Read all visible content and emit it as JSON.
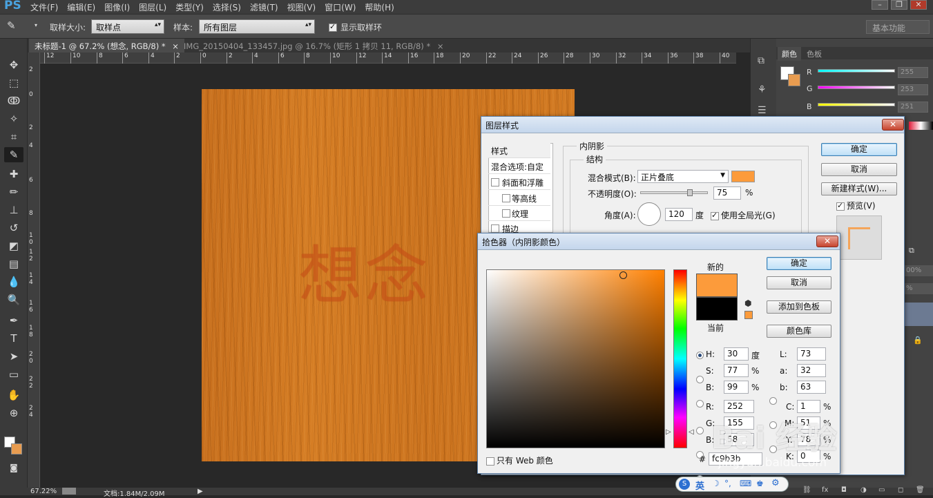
{
  "app": {
    "logo": "PS"
  },
  "menubar": {
    "items": [
      "文件(F)",
      "编辑(E)",
      "图像(I)",
      "图层(L)",
      "类型(Y)",
      "选择(S)",
      "滤镜(T)",
      "视图(V)",
      "窗口(W)",
      "帮助(H)"
    ]
  },
  "options": {
    "sample_size_label": "取样大小:",
    "sample_size_value": "取样点",
    "sample_label": "样本:",
    "sample_value": "所有图层",
    "show_ring_label": "显示取样环",
    "show_ring_checked": true,
    "workspace": "基本功能"
  },
  "tabs": [
    {
      "label": "未标题-1 @ 67.2% (想念, RGB/8) *",
      "active": true
    },
    {
      "label": "IMG_20150404_133457.jpg @ 16.7% (矩形 1 拷贝 11, RGB/8) *",
      "active": false
    }
  ],
  "ruler_h": [
    "12",
    "10",
    "8",
    "6",
    "4",
    "2",
    "0",
    "2",
    "4",
    "6",
    "8",
    "10",
    "12",
    "14",
    "16",
    "18",
    "20",
    "22",
    "24",
    "26",
    "28",
    "30",
    "32",
    "34",
    "36",
    "38",
    "40"
  ],
  "ruler_v": [
    "2",
    "0",
    "2",
    "4",
    "6",
    "8",
    "1 0",
    "1 2",
    "1 4",
    "1 6",
    "1 8",
    "2 0",
    "2 2",
    "2 4"
  ],
  "canvas": {
    "text": "想念"
  },
  "status": {
    "zoom": "67.22%",
    "doc": "文档:1.84M/2.09M"
  },
  "color_panel": {
    "tabs": [
      "颜色",
      "色板"
    ],
    "r_label": "R",
    "g_label": "G",
    "b_label": "B",
    "r": "255",
    "g": "253",
    "b": "251"
  },
  "panel_extras": {
    "pct1": "00%",
    "pct2": "%"
  },
  "layer_style": {
    "title": "图层样式",
    "list": [
      "样式",
      "混合选项:自定",
      "斜面和浮雕",
      "等高线",
      "纹理",
      "描边"
    ],
    "section": "内阴影",
    "structure": "结构",
    "blend_mode_label": "混合模式(B):",
    "blend_mode_value": "正片叠底",
    "opacity_label": "不透明度(O):",
    "opacity_value": "75",
    "opacity_unit": "%",
    "angle_label": "角度(A):",
    "angle_value": "120",
    "angle_unit": "度",
    "global_light_label": "使用全局光(G)",
    "global_light_checked": true,
    "ok": "确定",
    "cancel": "取消",
    "new_style": "新建样式(W)...",
    "preview_label": "预览(V)",
    "preview_checked": true,
    "swatch_color": "#fc9b3b"
  },
  "color_picker": {
    "title": "拾色器（内阴影颜色）",
    "new_label": "新的",
    "current_label": "当前",
    "new_color": "#fc9b3b",
    "current_color": "#000000",
    "ok": "确定",
    "cancel": "取消",
    "add_swatch": "添加到色板",
    "color_lib": "颜色库",
    "fields_left": [
      {
        "label": "H:",
        "value": "30",
        "unit": "度",
        "checked": true
      },
      {
        "label": "S:",
        "value": "77",
        "unit": "%",
        "checked": false
      },
      {
        "label": "B:",
        "value": "99",
        "unit": "%",
        "checked": false
      },
      {
        "label": "R:",
        "value": "252",
        "unit": "",
        "checked": false
      },
      {
        "label": "G:",
        "value": "155",
        "unit": "",
        "checked": false
      },
      {
        "label": "B:",
        "value": "58",
        "unit": "",
        "checked": false
      }
    ],
    "fields_right": [
      {
        "label": "L:",
        "value": "73",
        "unit": ""
      },
      {
        "label": "a:",
        "value": "32",
        "unit": ""
      },
      {
        "label": "b:",
        "value": "63",
        "unit": ""
      },
      {
        "label": "C:",
        "value": "1",
        "unit": "%"
      },
      {
        "label": "M:",
        "value": "51",
        "unit": "%"
      },
      {
        "label": "Y:",
        "value": "78",
        "unit": "%"
      },
      {
        "label": "K:",
        "value": "0",
        "unit": "%"
      }
    ],
    "hex_label": "#",
    "hex_value": "fc9b3b",
    "web_only_label": "只有 Web 颜色"
  },
  "ime": {
    "lang": "英"
  },
  "watermark": {
    "brand": "Bai 经验",
    "url": "jingyan.baidu.com"
  }
}
